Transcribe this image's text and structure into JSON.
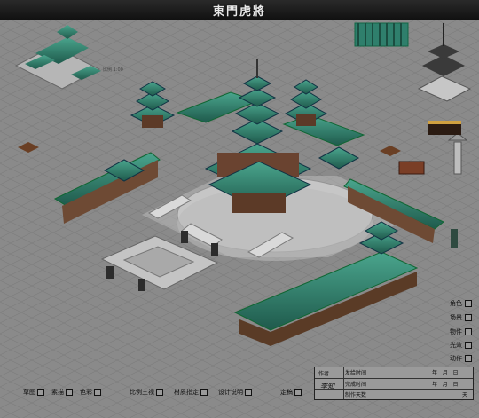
{
  "window": {
    "title": "東門虎將"
  },
  "annotation": {
    "text": "比例 1:00"
  },
  "layers": [
    {
      "label": "角色"
    },
    {
      "label": "场景"
    },
    {
      "label": "物件"
    },
    {
      "label": "光效"
    },
    {
      "label": "动作"
    }
  ],
  "bottom_tabs": [
    {
      "label": "草图"
    },
    {
      "label": "素描"
    },
    {
      "label": "色彩"
    },
    {
      "label": "比例三视"
    },
    {
      "label": "材质指定"
    },
    {
      "label": "设计说明"
    },
    {
      "label": "定稿"
    }
  ],
  "info": {
    "author_label": "作者",
    "signature": "李知",
    "rows": [
      {
        "label": "发给时间",
        "y": "年",
        "m": "月",
        "d": "日"
      },
      {
        "label": "完成时间",
        "y": "年",
        "m": "月",
        "d": "日"
      },
      {
        "label": "制作天数",
        "days": "天"
      }
    ]
  },
  "colors": {
    "roof": "#2f6f5f",
    "stone": "#c9c9c9",
    "wood": "#5a3b26",
    "bg": "#8a8a8a"
  }
}
